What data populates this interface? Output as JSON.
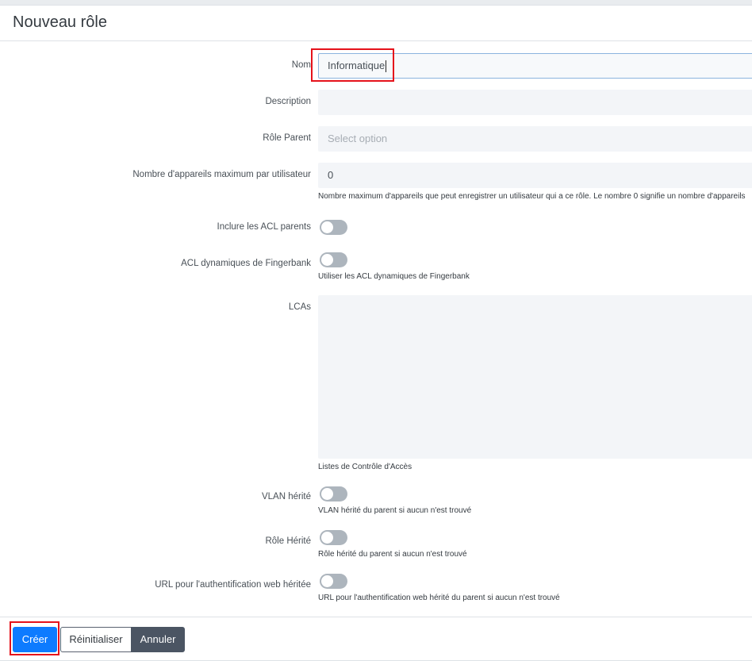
{
  "modal": {
    "title": "Nouveau rôle"
  },
  "form": {
    "name": {
      "label": "Nom",
      "value": "Informatique"
    },
    "description": {
      "label": "Description",
      "value": ""
    },
    "parent_role": {
      "label": "Rôle Parent",
      "placeholder": "Select option"
    },
    "max_devices": {
      "label": "Nombre d'appareils maximum par utilisateur",
      "value": "0",
      "help": "Nombre maximum d'appareils que peut enregistrer un utilisateur qui a ce rôle. Le nombre 0 signifie un nombre d'appareils"
    },
    "include_parent_acls": {
      "label": "Inclure les ACL parents",
      "checked": false
    },
    "fingerbank_dynamic_acls": {
      "label": "ACL dynamiques de Fingerbank",
      "checked": false,
      "help": "Utiliser les ACL dynamiques de Fingerbank"
    },
    "acls": {
      "label": "LCAs",
      "value": "",
      "help": "Listes de Contrôle d'Accès"
    },
    "inherit_vlan": {
      "label": "VLAN hérité",
      "checked": false,
      "help": "VLAN hérité du parent si aucun n'est trouvé"
    },
    "inherit_role": {
      "label": "Rôle Hérité",
      "checked": false,
      "help": "Rôle hérité du parent si aucun n'est trouvé"
    },
    "inherit_web_auth_url": {
      "label": "URL pour l'authentification web héritée",
      "checked": false,
      "help": "URL pour l'authentification web hérité du parent si aucun n'est trouvé"
    }
  },
  "footer": {
    "create_label": "Créer",
    "reset_label": "Réinitialiser",
    "cancel_label": "Annuler"
  },
  "colors": {
    "primary": "#0d7bff",
    "highlight": "#e5121b",
    "toggle_off": "#adb5bd",
    "input_bg": "#f3f5f8"
  }
}
